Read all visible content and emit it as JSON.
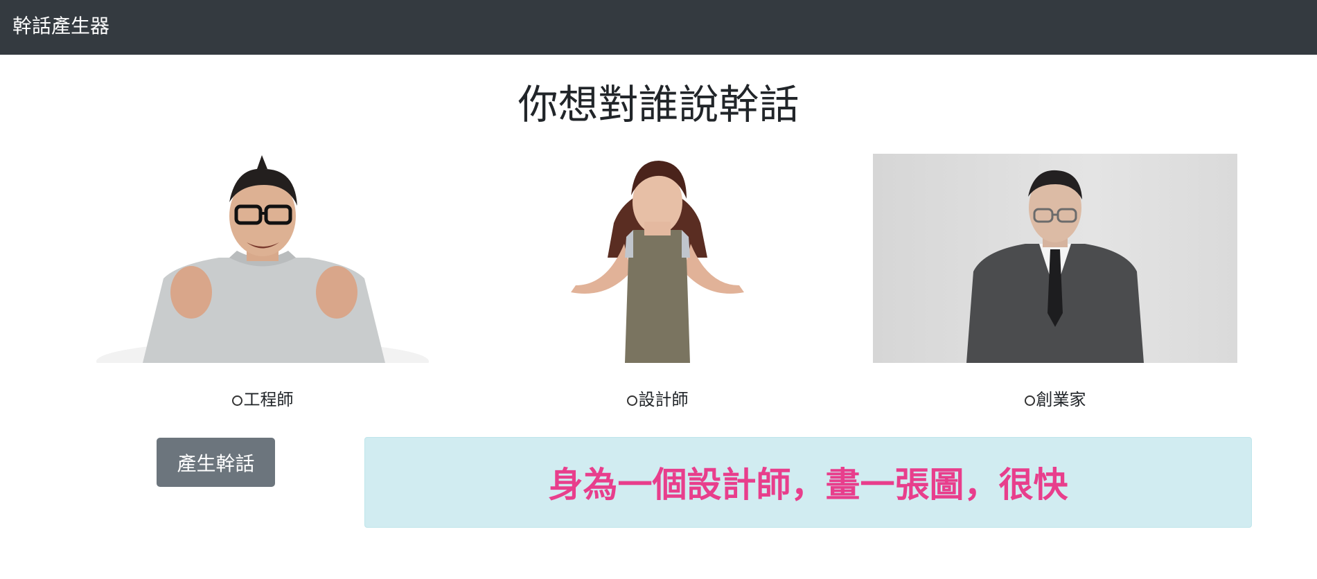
{
  "navbar": {
    "brand": "幹話產生器"
  },
  "main": {
    "title": "你想對誰說幹話",
    "options": [
      {
        "label": "工程師",
        "selected": false
      },
      {
        "label": "設計師",
        "selected": false
      },
      {
        "label": "創業家",
        "selected": false
      }
    ],
    "generate_button": "產生幹話",
    "result": "身為一個設計師，畫一張圖，很快"
  },
  "colors": {
    "navbar": "#343a40",
    "button": "#6c757d",
    "result_background": "#d1ecf1",
    "result_text": "#e83e8c"
  }
}
